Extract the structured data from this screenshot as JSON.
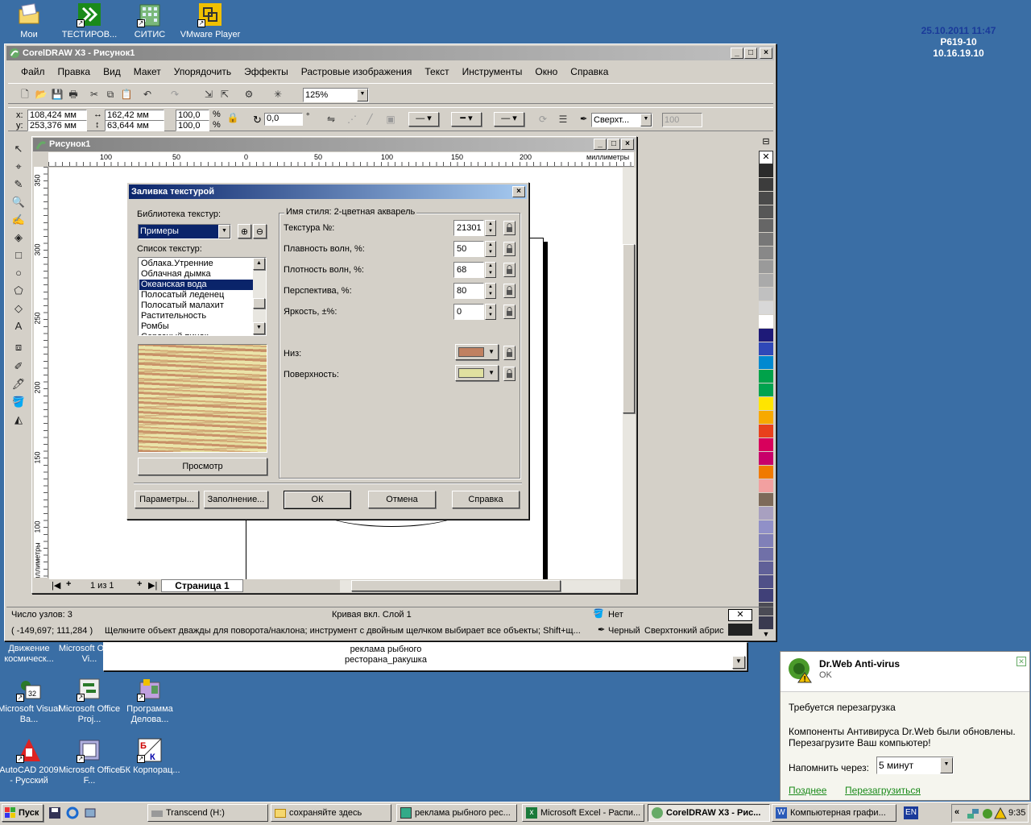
{
  "desktop": {
    "top_icons": [
      {
        "label": "Мои",
        "icon": "folder-icon"
      },
      {
        "label": "ТЕСТИРОВ...",
        "icon": "test-app-icon"
      },
      {
        "label": "СИТИС",
        "icon": "building-icon"
      },
      {
        "label": "VMware Player",
        "icon": "vmware-icon"
      }
    ],
    "left_icons": [
      {
        "label": "Движение космическ...",
        "icon": "app-icon"
      },
      {
        "label": "Microsoft Office Vi...",
        "icon": "visio-icon"
      },
      {
        "label": "Microsoft Visual Ba...",
        "icon": "vb-icon"
      },
      {
        "label": "Microsoft Office Proj...",
        "icon": "project-icon"
      },
      {
        "label": "Программа Делова...",
        "icon": "program-icon"
      },
      {
        "label": "AutoCAD 2009 - Русский",
        "icon": "autocad-icon"
      },
      {
        "label": "Microsoft Office F...",
        "icon": "frontpage-icon"
      },
      {
        "label": "БК Корпорац...",
        "icon": "bk-icon"
      }
    ],
    "info_datetime": "25.10.2011 11:47",
    "info_host": "P619-10",
    "info_ip": "10.16.19.10"
  },
  "corel": {
    "title": "CorelDRAW X3 - Рисунок1",
    "menu": [
      "Файл",
      "Правка",
      "Вид",
      "Макет",
      "Упорядочить",
      "Эффекты",
      "Растровые изображения",
      "Текст",
      "Инструменты",
      "Окно",
      "Справка"
    ],
    "zoom": "125%",
    "prop": {
      "x": "108,424 мм",
      "y": "253,376 мм",
      "w": "162,42 мм",
      "h": "63,644 мм",
      "sx": "100,0",
      "sy": "100,0",
      "pct1": "%",
      "pct2": "%",
      "angle": "0,0",
      "deg": "°",
      "outline": "Сверхт...",
      "opacity": "100"
    },
    "doc_title": "Рисунок1",
    "ruler_labels": [
      "100",
      "50",
      "0",
      "50",
      "100",
      "150",
      "200"
    ],
    "ruler_unit": "миллиметры",
    "vruler_labels": [
      "350",
      "300",
      "250",
      "200",
      "150",
      "100"
    ],
    "vruler_unit": "миллиметры",
    "page_nav": "1 из 1",
    "page_tab": "Страница 1",
    "status": {
      "nodes": "Число узлов: 3",
      "layer": "Кривая вкл. Слой 1",
      "fill": "Нет",
      "coords": "( -149,697; 111,284 )",
      "hint": "Щелкните объект дважды для поворота/наклона; инструмент с двойным щелчком выбирает все объекты; Shift+щ...",
      "outline_color": "Черный",
      "outline_width": "Сверхтонкий абрис"
    },
    "palette": [
      "#2b2b2b",
      "#3c3c3c",
      "#4a4a4a",
      "#575757",
      "#666666",
      "#777777",
      "#888888",
      "#9a9a9a",
      "#aaaaaa",
      "#c0c0c0",
      "#d8d8d8",
      "#ffffff",
      "#1e1a78",
      "#2f48b8",
      "#0089d0",
      "#00a24a",
      "#00a34f",
      "#ffe500",
      "#f7a900",
      "#e8401c",
      "#d8005c",
      "#c8006a",
      "#f07a00",
      "#f2a0a0",
      "#7d6a5a",
      "#a8a0c0",
      "#9090c8",
      "#8080b8",
      "#7070a8",
      "#606098",
      "#505088",
      "#404078",
      "#4b4b55",
      "#3a3a50"
    ]
  },
  "dialog": {
    "title": "Заливка текстурой",
    "library_label": "Библиотека текстур:",
    "library_value": "Примеры",
    "list_label": "Список текстур:",
    "list_items": [
      "Облака.Утренние",
      "Облачная дымка",
      "Океанская вода",
      "Полосатый леденец",
      "Полосатый малахит",
      "Растительность",
      "Ромбы",
      "Серозный пинок"
    ],
    "selected_index": 2,
    "preview_button": "Просмотр",
    "style_name": "Имя стиля: 2-цветная акварель",
    "params": [
      {
        "label": "Текстура №:",
        "value": "21301"
      },
      {
        "label": "Плавность волн, %:",
        "value": "50"
      },
      {
        "label": "Плотность волн, %:",
        "value": "68"
      },
      {
        "label": "Перспектива, %:",
        "value": "80"
      },
      {
        "label": "Яркость, ±%:",
        "value": "0"
      }
    ],
    "bottom_label": "Низ:",
    "bottom_color": "#c08060",
    "surface_label": "Поверхность:",
    "surface_color": "#e0e0a0",
    "buttons": {
      "params": "Параметры...",
      "fill": "Заполнение...",
      "ok": "ОК",
      "cancel": "Отмена",
      "help": "Справка"
    }
  },
  "listwin": {
    "line1": "реклама рыбного",
    "line2": "ресторана_ракушка"
  },
  "drweb": {
    "title": "Dr.Web Anti-virus",
    "subtitle": "OK",
    "heading": "Требуется перезагрузка",
    "body": "Компоненты Антивируса Dr.Web были обновлены. Перезагрузите Ваш компьютер!",
    "remind_label": "Напомнить через:",
    "remind_value": "5 минут",
    "later": "Позднее",
    "restart": "Перезагрузиться"
  },
  "taskbar": {
    "start": "Пуск",
    "items": [
      "Transcend (H:)",
      "сохраняйте здесь",
      "реклама рыбного рес...",
      "Microsoft Excel - Распи...",
      "CorelDRAW X3 - Рис...",
      "Компьютерная графи..."
    ],
    "lang": "EN",
    "clock": "9:35",
    "chevron": "«"
  }
}
